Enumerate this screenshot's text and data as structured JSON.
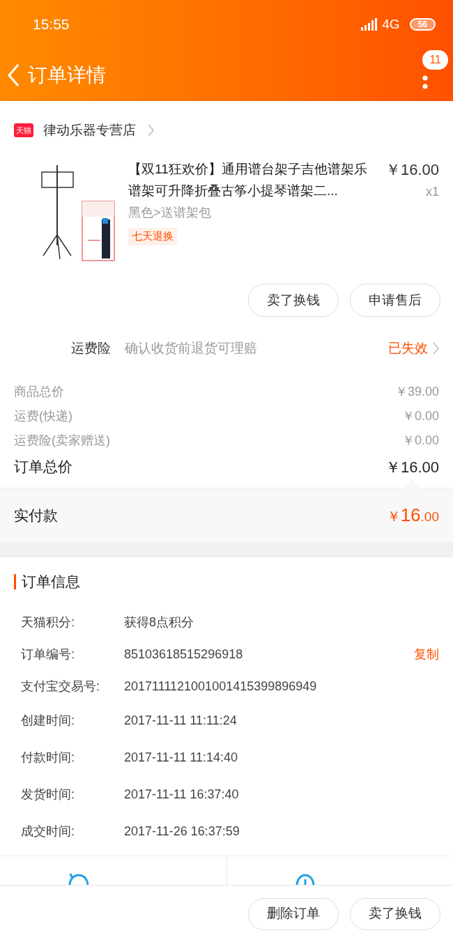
{
  "status_bar": {
    "time": "15:55",
    "network": "4G",
    "battery": "56"
  },
  "header": {
    "title": "订单详情",
    "badge": "11"
  },
  "shop": {
    "badge": "天猫",
    "name": "律动乐器专营店"
  },
  "product": {
    "title": "【双11狂欢价】通用谱台架子吉他谱架乐谱架可升降折叠古筝小提琴谱架二...",
    "sku": "黑色>送谱架包",
    "tag": "七天退换",
    "price": "￥16.00",
    "quantity": "x1"
  },
  "product_actions": [
    "卖了换钱",
    "申请售后"
  ],
  "insurance": {
    "label": "运费险",
    "description": "确认收货前退货可理赔",
    "status": "已失效"
  },
  "price_lines": [
    {
      "label": "商品总价",
      "value": "￥39.00",
      "kind": "minor"
    },
    {
      "label": "运费(快递)",
      "value": "￥0.00",
      "kind": "minor"
    },
    {
      "label": "运费险(卖家赠送)",
      "value": "￥0.00",
      "kind": "minor"
    },
    {
      "label": "订单总价",
      "value": "￥16.00",
      "kind": "major"
    }
  ],
  "paid": {
    "label": "实付款",
    "currency": "￥",
    "integer": "16",
    "decimals": ".00"
  },
  "order_info": {
    "title": "订单信息",
    "rows": [
      {
        "label": "天猫积分:",
        "value": "获得8点积分"
      },
      {
        "label": "订单编号:",
        "value": "85103618515296918",
        "action": "复制"
      },
      {
        "label": "支付宝交易号:",
        "value": "2017111121001001415399896949"
      },
      {
        "label": "创建时间:",
        "value": "2017-11-11 11:11:24"
      },
      {
        "label": "付款时间:",
        "value": "2017-11-11 11:14:40"
      },
      {
        "label": "发货时间:",
        "value": "2017-11-11 16:37:40"
      },
      {
        "label": "成交时间:",
        "value": "2017-11-26 16:37:59"
      }
    ]
  },
  "bottom_actions": [
    "删除订单",
    "卖了换钱"
  ]
}
